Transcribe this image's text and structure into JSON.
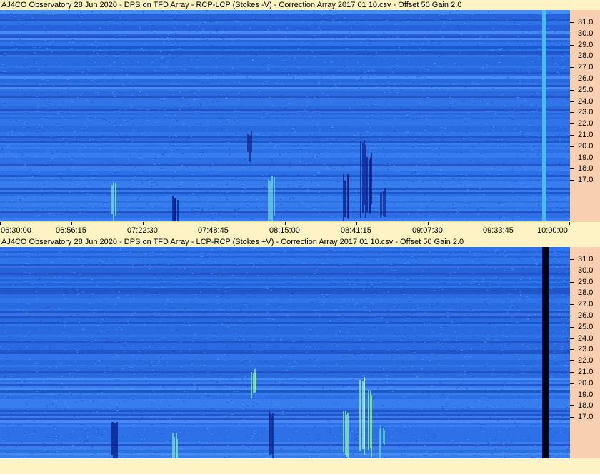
{
  "panels": [
    {
      "title": "AJ4CO Observatory 28 Jun 2020  -  DPS on TFD Array  -  RCP-LCP (Stokes -V)  -  Correction Array 2017 01 10.csv  -  Offset 50  Gain 2.0",
      "marker_color": "#3fc3e6",
      "show_time_axis": true
    },
    {
      "title": "AJ4CO Observatory 28 Jun 2020  -  DPS on TFD Array  -  LCP-RCP (Stokes +V)  -  Correction Array 2017 01 10.csv  -  Offset 50  Gain 2.0",
      "marker_color": "#02040e",
      "show_time_axis": false
    }
  ],
  "frequency_axis": {
    "labels": [
      "31.0",
      "30.0",
      "29.0",
      "28.0",
      "27.0",
      "26.0",
      "25.0",
      "24.0",
      "23.0",
      "22.0",
      "21.0",
      "20.0",
      "19.0",
      "18.0",
      "17.0"
    ]
  },
  "time_axis": {
    "labels": [
      "06:30:00",
      "06:56:15",
      "07:22:30",
      "07:48:45",
      "08:15:00",
      "08:41:15",
      "09:07:30",
      "09:33:45",
      "10:00:00"
    ]
  },
  "colors": {
    "background": "#fdf3c4",
    "freq_axis_bg": "#f8cfb0",
    "spectrogram_base": "#2a6ae0"
  }
}
